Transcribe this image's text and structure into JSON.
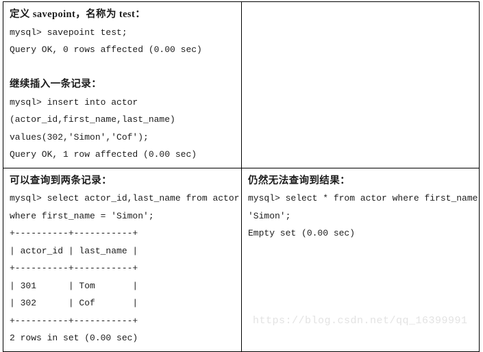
{
  "document": {
    "watermark": "https://blog.csdn.net/qq_16399991"
  },
  "table": {
    "rows": [
      {
        "name": "savepoint-and-insert-row",
        "left_cell": {
          "name": "savepoint-insert-cell",
          "lines": [
            "定义 savepoint，名称为 test：",
            "mysql> savepoint test;",
            "Query OK, 0 rows affected (0.00 sec)",
            "",
            "继续插入一条记录：",
            "mysql> insert into actor",
            "(actor_id,first_name,last_name)",
            "values(302,'Simon','Cof');",
            "Query OK, 1 row affected (0.00 sec)"
          ],
          "cn_line_indexes": [
            0,
            4
          ]
        },
        "right_cell": {
          "name": "empty-cell",
          "lines": [],
          "cn_line_indexes": []
        }
      },
      {
        "name": "query-results-row",
        "left_cell": {
          "name": "two-records-result-cell",
          "lines": [
            "可以查询到两条记录：",
            "mysql> select actor_id,last_name from actor",
            "where first_name = 'Simon';",
            "+----------+-----------+",
            "| actor_id | last_name |",
            "+----------+-----------+",
            "| 301      | Tom       |",
            "| 302      | Cof       |",
            "+----------+-----------+",
            "2 rows in set (0.00 sec)"
          ],
          "cn_line_indexes": [
            0
          ]
        },
        "right_cell": {
          "name": "empty-set-result-cell",
          "lines": [
            "仍然无法查询到结果：",
            "mysql> select * from actor where first_name =",
            "'Simon';",
            "Empty set (0.00 sec)"
          ],
          "cn_line_indexes": [
            0
          ]
        }
      }
    ]
  }
}
